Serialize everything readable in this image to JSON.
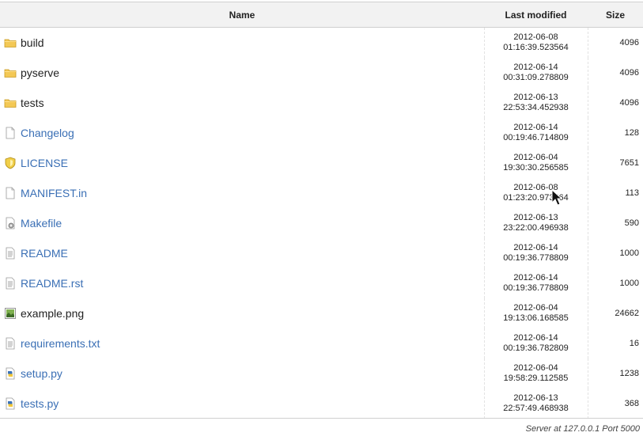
{
  "headers": {
    "name": "Name",
    "last_modified": "Last modified",
    "size": "Size"
  },
  "entries": [
    {
      "name": "build",
      "kind": "dir",
      "icon": "folder-icon",
      "date": "2012-06-08",
      "time": "01:16:39.523564",
      "size": "4096"
    },
    {
      "name": "pyserve",
      "kind": "dir",
      "icon": "folder-icon",
      "date": "2012-06-14",
      "time": "00:31:09.278809",
      "size": "4096"
    },
    {
      "name": "tests",
      "kind": "dir",
      "icon": "folder-icon",
      "date": "2012-06-13",
      "time": "22:53:34.452938",
      "size": "4096"
    },
    {
      "name": "Changelog",
      "kind": "file",
      "icon": "blank-file-icon",
      "date": "2012-06-14",
      "time": "00:19:46.714809",
      "size": "128"
    },
    {
      "name": "LICENSE",
      "kind": "file",
      "icon": "license-shield-icon",
      "date": "2012-06-04",
      "time": "19:30:30.256585",
      "size": "7651"
    },
    {
      "name": "MANIFEST.in",
      "kind": "file",
      "icon": "blank-file-icon",
      "date": "2012-06-08",
      "time": "01:23:20.973564",
      "size": "113"
    },
    {
      "name": "Makefile",
      "kind": "file",
      "icon": "makefile-gear-icon",
      "date": "2012-06-13",
      "time": "23:22:00.496938",
      "size": "590"
    },
    {
      "name": "README",
      "kind": "file",
      "icon": "text-file-icon",
      "date": "2012-06-14",
      "time": "00:19:36.778809",
      "size": "1000"
    },
    {
      "name": "README.rst",
      "kind": "file",
      "icon": "text-file-icon",
      "date": "2012-06-14",
      "time": "00:19:36.778809",
      "size": "1000"
    },
    {
      "name": "example.png",
      "kind": "img",
      "icon": "image-file-icon",
      "date": "2012-06-04",
      "time": "19:13:06.168585",
      "size": "24662"
    },
    {
      "name": "requirements.txt",
      "kind": "file",
      "icon": "text-file-icon",
      "date": "2012-06-14",
      "time": "00:19:36.782809",
      "size": "16"
    },
    {
      "name": "setup.py",
      "kind": "file",
      "icon": "python-file-icon",
      "date": "2012-06-04",
      "time": "19:58:29.112585",
      "size": "1238"
    },
    {
      "name": "tests.py",
      "kind": "file",
      "icon": "python-file-icon",
      "date": "2012-06-13",
      "time": "22:57:49.468938",
      "size": "368"
    }
  ],
  "footer": {
    "text": "Server at 127.0.0.1 Port 5000"
  },
  "colors": {
    "link": "#3a6fb5",
    "folder": "#e8b83a",
    "header_bg": "#f2f2f2"
  }
}
